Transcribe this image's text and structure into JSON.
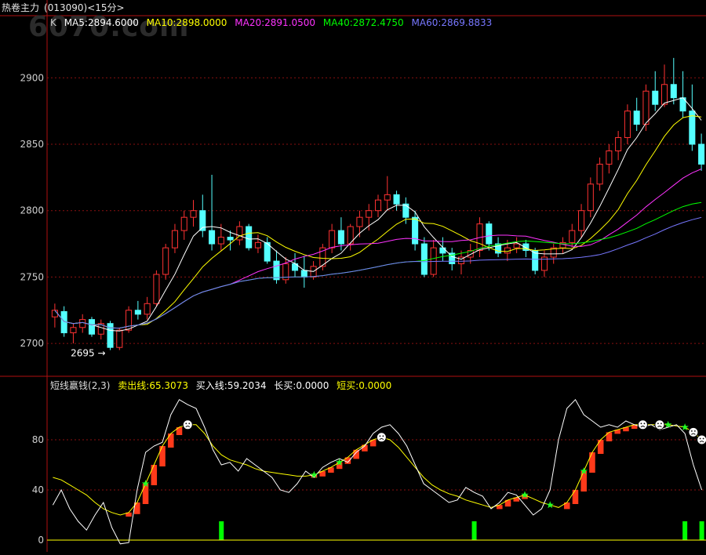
{
  "window": {
    "title": "热卷主力",
    "code": "(013090)",
    "period": "<15分>"
  },
  "watermark": "6070.com",
  "main_legend": {
    "prefix": "K",
    "items": [
      {
        "label": "MA5:2894.6000",
        "color": "#ffffff"
      },
      {
        "label": "MA10:2898.0000",
        "color": "#ffff00"
      },
      {
        "label": "MA20:2891.0500",
        "color": "#ff33ff"
      },
      {
        "label": "MA40:2872.4750",
        "color": "#00ff00"
      },
      {
        "label": "MA60:2869.8833",
        "color": "#7777ff"
      }
    ]
  },
  "indicator_legend": {
    "name": "短线赢钱",
    "params": "(2,3)",
    "items": [
      {
        "label": "卖出线:65.3073",
        "color": "#ffff00"
      },
      {
        "label": "买入线:59.2034",
        "color": "#ffffff"
      },
      {
        "label": "长买:0.0000",
        "color": "#ffffff"
      },
      {
        "label": "短买:0.0000",
        "color": "#ffff00"
      }
    ]
  },
  "low_marker": "2695",
  "chart_data": [
    {
      "type": "candlestick",
      "y_ticks": [
        2700,
        2750,
        2800,
        2850,
        2900
      ],
      "ylim": [
        2680,
        2935
      ],
      "grid": true,
      "candles": [
        {
          "o": 2720,
          "h": 2730,
          "l": 2712,
          "c": 2725
        },
        {
          "o": 2724,
          "h": 2728,
          "l": 2705,
          "c": 2708
        },
        {
          "o": 2708,
          "h": 2715,
          "l": 2700,
          "c": 2712
        },
        {
          "o": 2712,
          "h": 2722,
          "l": 2708,
          "c": 2718
        },
        {
          "o": 2718,
          "h": 2720,
          "l": 2705,
          "c": 2707
        },
        {
          "o": 2707,
          "h": 2718,
          "l": 2703,
          "c": 2715
        },
        {
          "o": 2715,
          "h": 2717,
          "l": 2695,
          "c": 2697
        },
        {
          "o": 2697,
          "h": 2712,
          "l": 2695,
          "c": 2710
        },
        {
          "o": 2710,
          "h": 2728,
          "l": 2708,
          "c": 2725
        },
        {
          "o": 2725,
          "h": 2732,
          "l": 2718,
          "c": 2722
        },
        {
          "o": 2722,
          "h": 2735,
          "l": 2718,
          "c": 2730
        },
        {
          "o": 2730,
          "h": 2755,
          "l": 2728,
          "c": 2752
        },
        {
          "o": 2752,
          "h": 2775,
          "l": 2748,
          "c": 2772
        },
        {
          "o": 2772,
          "h": 2790,
          "l": 2768,
          "c": 2785
        },
        {
          "o": 2785,
          "h": 2800,
          "l": 2778,
          "c": 2795
        },
        {
          "o": 2795,
          "h": 2808,
          "l": 2788,
          "c": 2800
        },
        {
          "o": 2800,
          "h": 2812,
          "l": 2780,
          "c": 2785
        },
        {
          "o": 2785,
          "h": 2827,
          "l": 2770,
          "c": 2775
        },
        {
          "o": 2775,
          "h": 2790,
          "l": 2770,
          "c": 2780
        },
        {
          "o": 2780,
          "h": 2785,
          "l": 2770,
          "c": 2778
        },
        {
          "o": 2778,
          "h": 2792,
          "l": 2774,
          "c": 2788
        },
        {
          "o": 2788,
          "h": 2790,
          "l": 2770,
          "c": 2772
        },
        {
          "o": 2772,
          "h": 2782,
          "l": 2768,
          "c": 2776
        },
        {
          "o": 2776,
          "h": 2780,
          "l": 2760,
          "c": 2762
        },
        {
          "o": 2762,
          "h": 2770,
          "l": 2745,
          "c": 2748
        },
        {
          "o": 2748,
          "h": 2765,
          "l": 2745,
          "c": 2760
        },
        {
          "o": 2760,
          "h": 2768,
          "l": 2750,
          "c": 2755
        },
        {
          "o": 2755,
          "h": 2766,
          "l": 2742,
          "c": 2750
        },
        {
          "o": 2750,
          "h": 2762,
          "l": 2748,
          "c": 2758
        },
        {
          "o": 2758,
          "h": 2775,
          "l": 2755,
          "c": 2772
        },
        {
          "o": 2772,
          "h": 2790,
          "l": 2768,
          "c": 2785
        },
        {
          "o": 2785,
          "h": 2795,
          "l": 2770,
          "c": 2775
        },
        {
          "o": 2775,
          "h": 2790,
          "l": 2770,
          "c": 2788
        },
        {
          "o": 2788,
          "h": 2800,
          "l": 2780,
          "c": 2795
        },
        {
          "o": 2795,
          "h": 2805,
          "l": 2785,
          "c": 2800
        },
        {
          "o": 2800,
          "h": 2812,
          "l": 2795,
          "c": 2808
        },
        {
          "o": 2808,
          "h": 2826,
          "l": 2800,
          "c": 2812
        },
        {
          "o": 2812,
          "h": 2815,
          "l": 2800,
          "c": 2805
        },
        {
          "o": 2805,
          "h": 2810,
          "l": 2790,
          "c": 2795
        },
        {
          "o": 2795,
          "h": 2800,
          "l": 2770,
          "c": 2775
        },
        {
          "o": 2775,
          "h": 2780,
          "l": 2750,
          "c": 2752
        },
        {
          "o": 2752,
          "h": 2778,
          "l": 2750,
          "c": 2772
        },
        {
          "o": 2772,
          "h": 2780,
          "l": 2762,
          "c": 2768
        },
        {
          "o": 2768,
          "h": 2772,
          "l": 2755,
          "c": 2760
        },
        {
          "o": 2760,
          "h": 2770,
          "l": 2752,
          "c": 2765
        },
        {
          "o": 2765,
          "h": 2775,
          "l": 2760,
          "c": 2770
        },
        {
          "o": 2770,
          "h": 2795,
          "l": 2765,
          "c": 2790
        },
        {
          "o": 2790,
          "h": 2792,
          "l": 2770,
          "c": 2775
        },
        {
          "o": 2775,
          "h": 2780,
          "l": 2765,
          "c": 2768
        },
        {
          "o": 2768,
          "h": 2778,
          "l": 2762,
          "c": 2772
        },
        {
          "o": 2772,
          "h": 2780,
          "l": 2768,
          "c": 2775
        },
        {
          "o": 2775,
          "h": 2778,
          "l": 2765,
          "c": 2770
        },
        {
          "o": 2770,
          "h": 2772,
          "l": 2752,
          "c": 2755
        },
        {
          "o": 2755,
          "h": 2770,
          "l": 2750,
          "c": 2765
        },
        {
          "o": 2765,
          "h": 2775,
          "l": 2760,
          "c": 2772
        },
        {
          "o": 2772,
          "h": 2780,
          "l": 2768,
          "c": 2776
        },
        {
          "o": 2776,
          "h": 2790,
          "l": 2772,
          "c": 2785
        },
        {
          "o": 2785,
          "h": 2805,
          "l": 2780,
          "c": 2800
        },
        {
          "o": 2800,
          "h": 2825,
          "l": 2795,
          "c": 2820
        },
        {
          "o": 2820,
          "h": 2840,
          "l": 2815,
          "c": 2835
        },
        {
          "o": 2835,
          "h": 2850,
          "l": 2828,
          "c": 2845
        },
        {
          "o": 2845,
          "h": 2860,
          "l": 2838,
          "c": 2855
        },
        {
          "o": 2855,
          "h": 2880,
          "l": 2850,
          "c": 2875
        },
        {
          "o": 2875,
          "h": 2885,
          "l": 2860,
          "c": 2865
        },
        {
          "o": 2865,
          "h": 2895,
          "l": 2860,
          "c": 2890
        },
        {
          "o": 2890,
          "h": 2905,
          "l": 2875,
          "c": 2880
        },
        {
          "o": 2880,
          "h": 2910,
          "l": 2878,
          "c": 2895
        },
        {
          "o": 2895,
          "h": 2915,
          "l": 2880,
          "c": 2885
        },
        {
          "o": 2885,
          "h": 2905,
          "l": 2870,
          "c": 2875
        },
        {
          "o": 2875,
          "h": 2895,
          "l": 2845,
          "c": 2850
        },
        {
          "o": 2850,
          "h": 2858,
          "l": 2830,
          "c": 2835
        }
      ],
      "ma_values": [
        2894.6,
        2898.0,
        2891.05,
        2872.475,
        2869.8833
      ]
    },
    {
      "type": "line",
      "y_ticks": [
        0,
        40,
        80
      ],
      "ylim": [
        -5,
        115
      ],
      "series": [
        {
          "name": "卖出线",
          "color": "#ffff00",
          "value": 65.3073
        },
        {
          "name": "买入线",
          "color": "#ffffff",
          "value": 59.2034
        },
        {
          "name": "长买",
          "color": "#00ff00",
          "value": 0
        },
        {
          "name": "短买",
          "color": "#ffff00",
          "value": 0
        }
      ],
      "sell_line": [
        50,
        48,
        44,
        40,
        36,
        30,
        25,
        22,
        20,
        22,
        30,
        45,
        60,
        75,
        85,
        90,
        92,
        92,
        85,
        75,
        68,
        64,
        62,
        60,
        57,
        55,
        54,
        53,
        52,
        51,
        51,
        52,
        55,
        58,
        62,
        66,
        72,
        76,
        80,
        82,
        80,
        74,
        66,
        58,
        50,
        44,
        40,
        37,
        35,
        32,
        30,
        28,
        26,
        28,
        32,
        34,
        36,
        33,
        30,
        28,
        26,
        30,
        40,
        55,
        70,
        80,
        86,
        88,
        90,
        92,
        92,
        92,
        92,
        92,
        91,
        90,
        86,
        80
      ],
      "buy_line": [
        28,
        40,
        25,
        15,
        8,
        20,
        30,
        10,
        -3,
        -2,
        40,
        70,
        75,
        78,
        100,
        112,
        108,
        105,
        90,
        72,
        60,
        62,
        55,
        65,
        60,
        55,
        50,
        40,
        38,
        45,
        55,
        50,
        58,
        62,
        65,
        62,
        70,
        75,
        85,
        90,
        92,
        85,
        75,
        60,
        45,
        40,
        35,
        30,
        32,
        42,
        38,
        35,
        25,
        30,
        38,
        36,
        28,
        20,
        25,
        40,
        80,
        105,
        112,
        100,
        95,
        90,
        92,
        90,
        95,
        92,
        90,
        92,
        88,
        90,
        92,
        85,
        60,
        40
      ],
      "green_bars_at": [
        20,
        50,
        75,
        77,
        79,
        80
      ]
    }
  ]
}
